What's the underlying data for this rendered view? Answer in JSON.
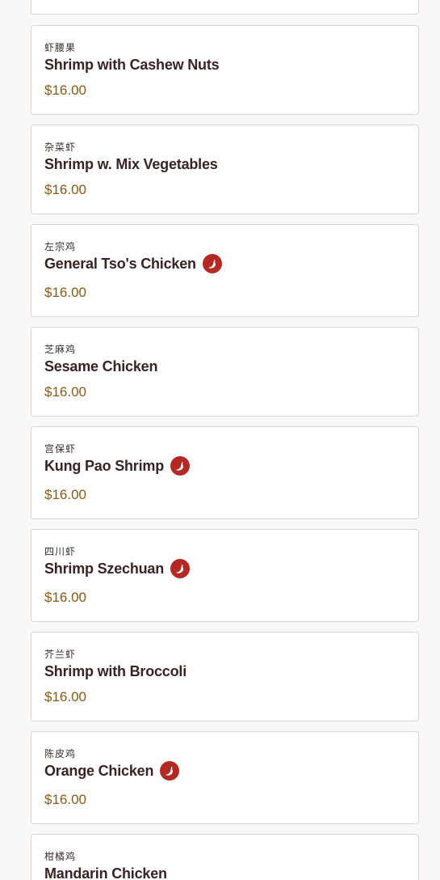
{
  "menu": {
    "items": [
      {
        "cn": "",
        "name": "",
        "price": "",
        "spicy": false
      },
      {
        "cn": "虾腰果",
        "name": "Shrimp with Cashew Nuts",
        "price": "$16.00",
        "spicy": false
      },
      {
        "cn": "杂菜虾",
        "name": "Shrimp w. Mix Vegetables",
        "price": "$16.00",
        "spicy": false
      },
      {
        "cn": "左宗鸡",
        "name": "General Tso's Chicken",
        "price": "$16.00",
        "spicy": true
      },
      {
        "cn": "芝麻鸡",
        "name": "Sesame Chicken",
        "price": "$16.00",
        "spicy": false
      },
      {
        "cn": "宫保虾",
        "name": "Kung Pao Shrimp",
        "price": "$16.00",
        "spicy": true
      },
      {
        "cn": "四川虾",
        "name": "Shrimp Szechuan",
        "price": "$16.00",
        "spicy": true
      },
      {
        "cn": "芥兰虾",
        "name": "Shrimp with Broccoli",
        "price": "$16.00",
        "spicy": false
      },
      {
        "cn": "陈皮鸡",
        "name": "Orange Chicken",
        "price": "$16.00",
        "spicy": true
      },
      {
        "cn": "柑橘鸡",
        "name": "Mandarin Chicken",
        "price": "",
        "spicy": false
      }
    ]
  },
  "colors": {
    "spicy_badge": "#b32a24",
    "price": "#8a5a12",
    "name": "#3a2323"
  },
  "icons": {
    "spicy": "chili-pepper-icon"
  }
}
